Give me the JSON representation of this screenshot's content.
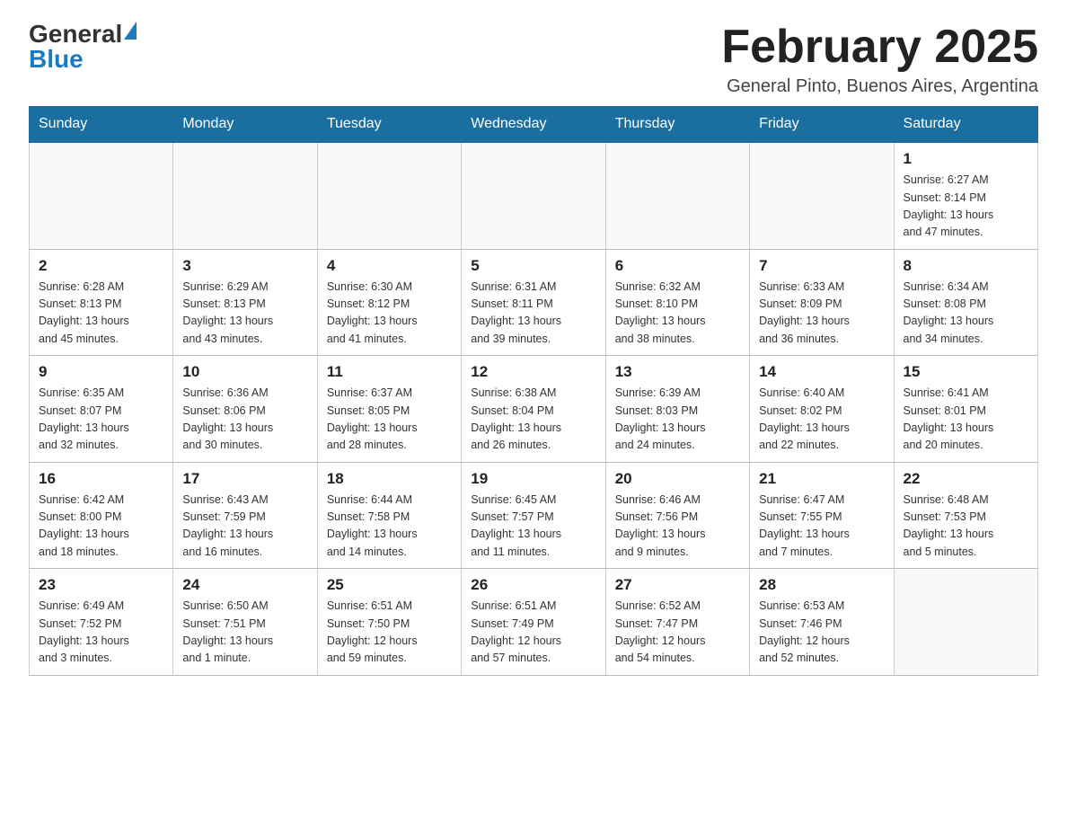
{
  "header": {
    "logo_general": "General",
    "logo_blue": "Blue",
    "month_title": "February 2025",
    "location": "General Pinto, Buenos Aires, Argentina"
  },
  "weekdays": [
    "Sunday",
    "Monday",
    "Tuesday",
    "Wednesday",
    "Thursday",
    "Friday",
    "Saturday"
  ],
  "weeks": [
    [
      {
        "day": "",
        "info": ""
      },
      {
        "day": "",
        "info": ""
      },
      {
        "day": "",
        "info": ""
      },
      {
        "day": "",
        "info": ""
      },
      {
        "day": "",
        "info": ""
      },
      {
        "day": "",
        "info": ""
      },
      {
        "day": "1",
        "info": "Sunrise: 6:27 AM\nSunset: 8:14 PM\nDaylight: 13 hours\nand 47 minutes."
      }
    ],
    [
      {
        "day": "2",
        "info": "Sunrise: 6:28 AM\nSunset: 8:13 PM\nDaylight: 13 hours\nand 45 minutes."
      },
      {
        "day": "3",
        "info": "Sunrise: 6:29 AM\nSunset: 8:13 PM\nDaylight: 13 hours\nand 43 minutes."
      },
      {
        "day": "4",
        "info": "Sunrise: 6:30 AM\nSunset: 8:12 PM\nDaylight: 13 hours\nand 41 minutes."
      },
      {
        "day": "5",
        "info": "Sunrise: 6:31 AM\nSunset: 8:11 PM\nDaylight: 13 hours\nand 39 minutes."
      },
      {
        "day": "6",
        "info": "Sunrise: 6:32 AM\nSunset: 8:10 PM\nDaylight: 13 hours\nand 38 minutes."
      },
      {
        "day": "7",
        "info": "Sunrise: 6:33 AM\nSunset: 8:09 PM\nDaylight: 13 hours\nand 36 minutes."
      },
      {
        "day": "8",
        "info": "Sunrise: 6:34 AM\nSunset: 8:08 PM\nDaylight: 13 hours\nand 34 minutes."
      }
    ],
    [
      {
        "day": "9",
        "info": "Sunrise: 6:35 AM\nSunset: 8:07 PM\nDaylight: 13 hours\nand 32 minutes."
      },
      {
        "day": "10",
        "info": "Sunrise: 6:36 AM\nSunset: 8:06 PM\nDaylight: 13 hours\nand 30 minutes."
      },
      {
        "day": "11",
        "info": "Sunrise: 6:37 AM\nSunset: 8:05 PM\nDaylight: 13 hours\nand 28 minutes."
      },
      {
        "day": "12",
        "info": "Sunrise: 6:38 AM\nSunset: 8:04 PM\nDaylight: 13 hours\nand 26 minutes."
      },
      {
        "day": "13",
        "info": "Sunrise: 6:39 AM\nSunset: 8:03 PM\nDaylight: 13 hours\nand 24 minutes."
      },
      {
        "day": "14",
        "info": "Sunrise: 6:40 AM\nSunset: 8:02 PM\nDaylight: 13 hours\nand 22 minutes."
      },
      {
        "day": "15",
        "info": "Sunrise: 6:41 AM\nSunset: 8:01 PM\nDaylight: 13 hours\nand 20 minutes."
      }
    ],
    [
      {
        "day": "16",
        "info": "Sunrise: 6:42 AM\nSunset: 8:00 PM\nDaylight: 13 hours\nand 18 minutes."
      },
      {
        "day": "17",
        "info": "Sunrise: 6:43 AM\nSunset: 7:59 PM\nDaylight: 13 hours\nand 16 minutes."
      },
      {
        "day": "18",
        "info": "Sunrise: 6:44 AM\nSunset: 7:58 PM\nDaylight: 13 hours\nand 14 minutes."
      },
      {
        "day": "19",
        "info": "Sunrise: 6:45 AM\nSunset: 7:57 PM\nDaylight: 13 hours\nand 11 minutes."
      },
      {
        "day": "20",
        "info": "Sunrise: 6:46 AM\nSunset: 7:56 PM\nDaylight: 13 hours\nand 9 minutes."
      },
      {
        "day": "21",
        "info": "Sunrise: 6:47 AM\nSunset: 7:55 PM\nDaylight: 13 hours\nand 7 minutes."
      },
      {
        "day": "22",
        "info": "Sunrise: 6:48 AM\nSunset: 7:53 PM\nDaylight: 13 hours\nand 5 minutes."
      }
    ],
    [
      {
        "day": "23",
        "info": "Sunrise: 6:49 AM\nSunset: 7:52 PM\nDaylight: 13 hours\nand 3 minutes."
      },
      {
        "day": "24",
        "info": "Sunrise: 6:50 AM\nSunset: 7:51 PM\nDaylight: 13 hours\nand 1 minute."
      },
      {
        "day": "25",
        "info": "Sunrise: 6:51 AM\nSunset: 7:50 PM\nDaylight: 12 hours\nand 59 minutes."
      },
      {
        "day": "26",
        "info": "Sunrise: 6:51 AM\nSunset: 7:49 PM\nDaylight: 12 hours\nand 57 minutes."
      },
      {
        "day": "27",
        "info": "Sunrise: 6:52 AM\nSunset: 7:47 PM\nDaylight: 12 hours\nand 54 minutes."
      },
      {
        "day": "28",
        "info": "Sunrise: 6:53 AM\nSunset: 7:46 PM\nDaylight: 12 hours\nand 52 minutes."
      },
      {
        "day": "",
        "info": ""
      }
    ]
  ]
}
